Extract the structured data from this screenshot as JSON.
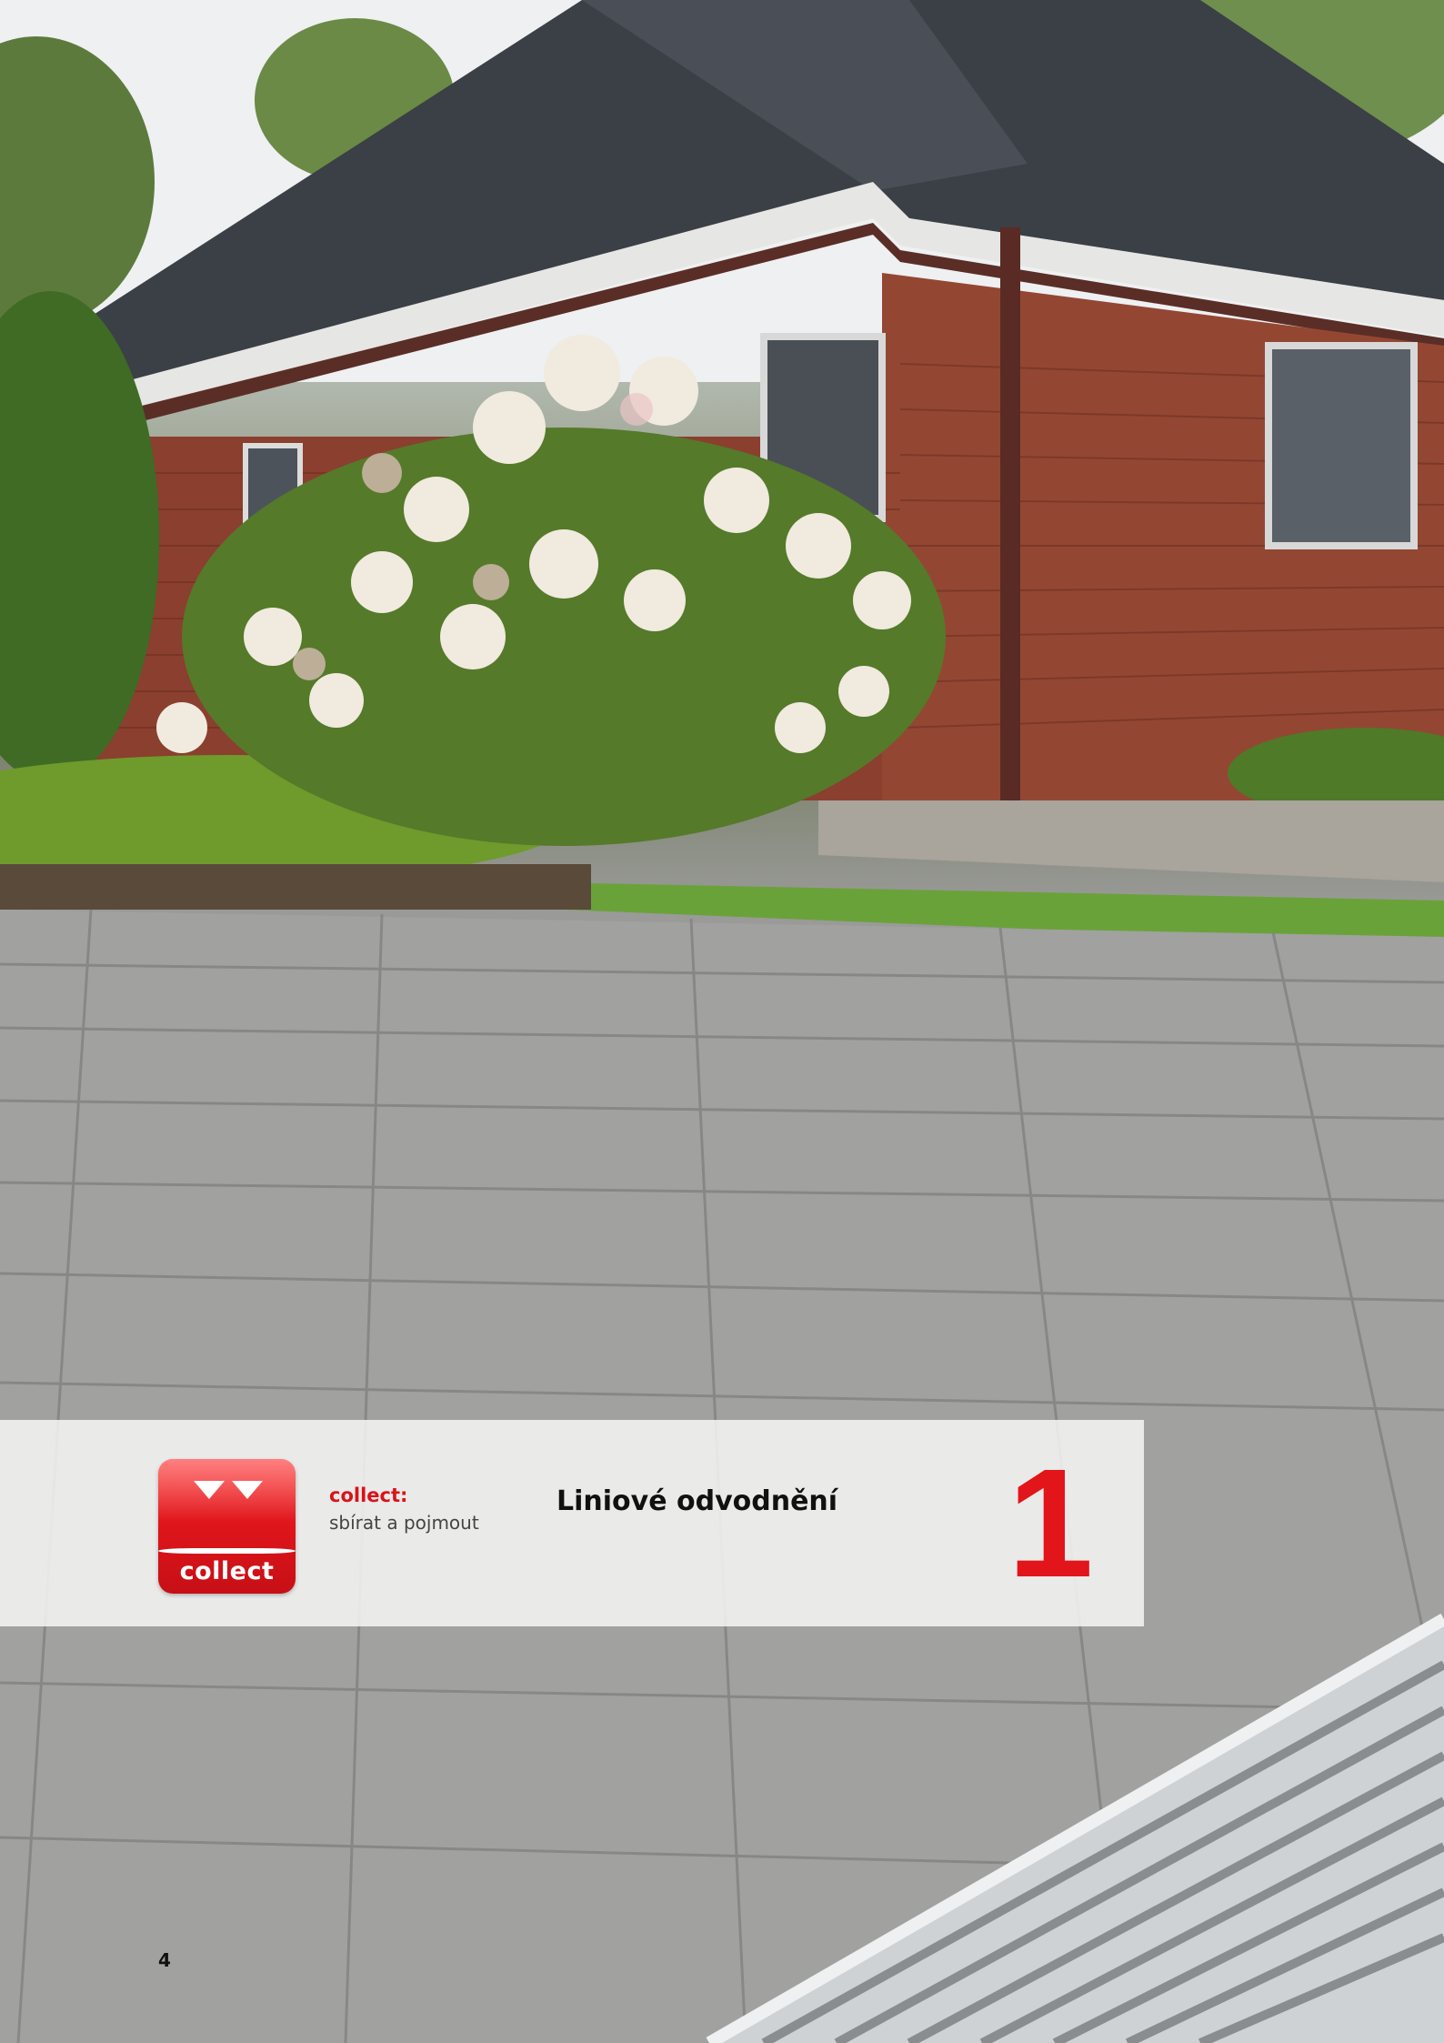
{
  "banner": {
    "logo_text": "collect",
    "tag_title": "collect:",
    "tag_subtitle": "sbírat a pojmout",
    "section_title": "Liniové odvodnění",
    "section_number": "1"
  },
  "footer": {
    "page_number": "4"
  },
  "colors": {
    "accent_red": "#e2151b",
    "banner_bg": "#f4f4f4"
  },
  "photo": {
    "subject": "house-with-garden-and-paved-driveway-with-drainage-grate-icon"
  }
}
